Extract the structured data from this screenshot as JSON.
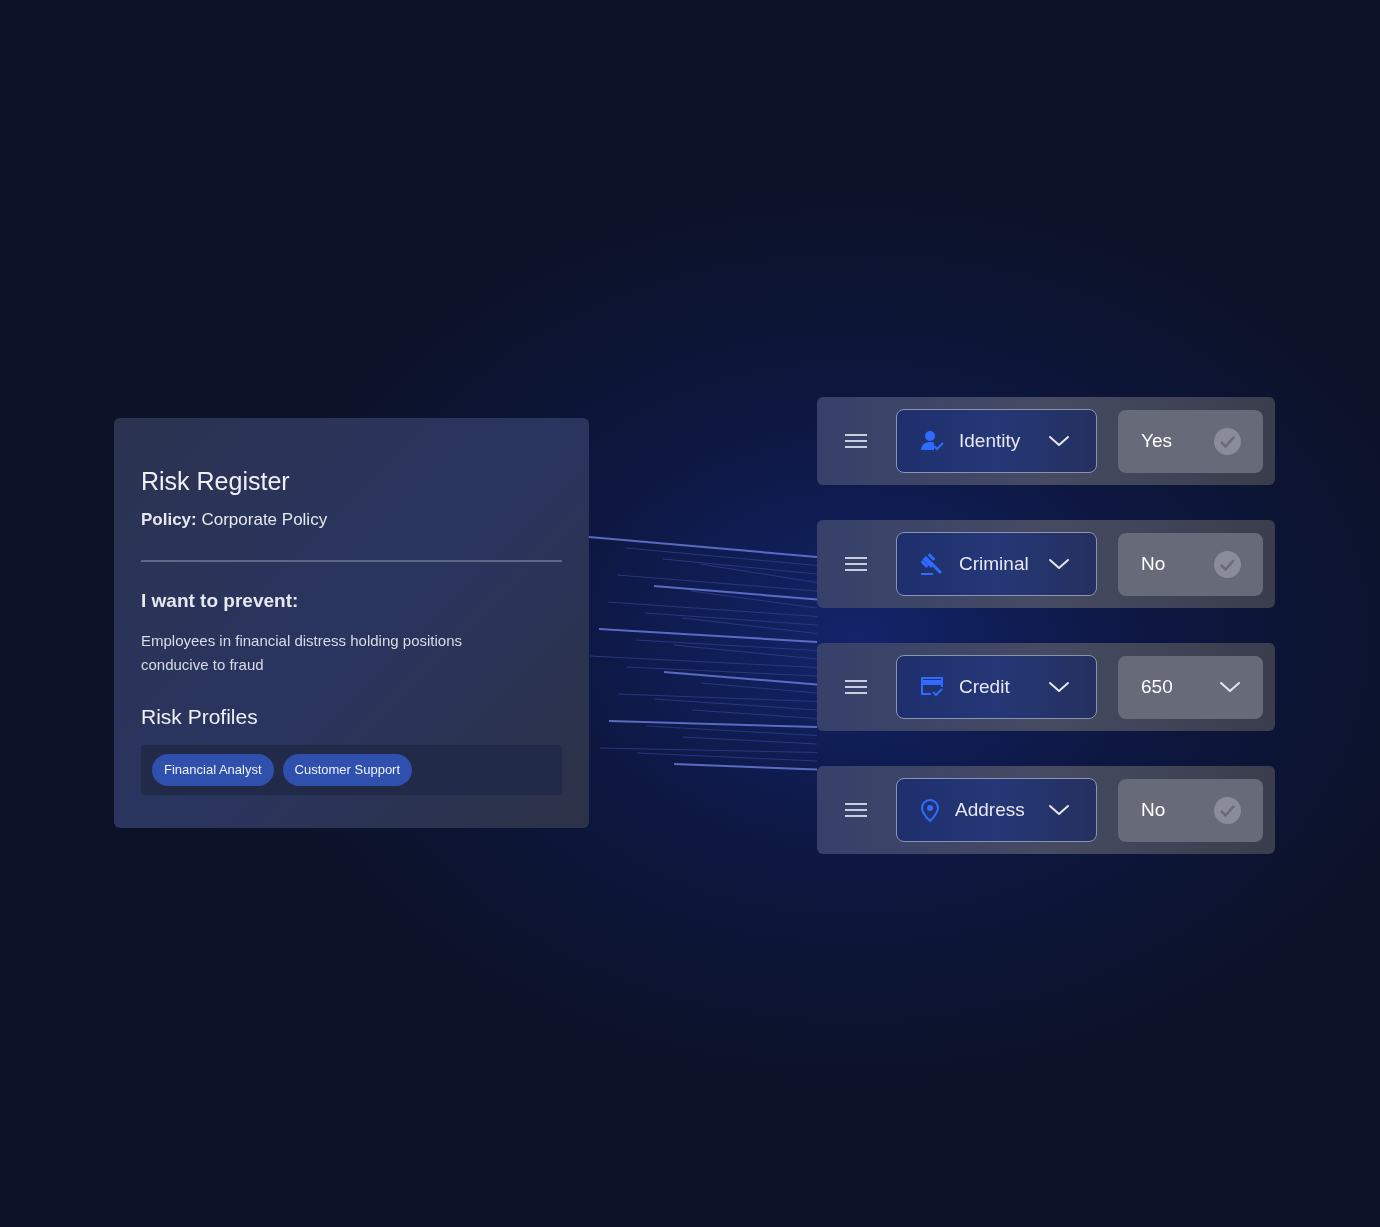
{
  "card": {
    "title": "Risk Register",
    "policy": "**Policy:** Corporate Policy",
    "prevent_heading": "I want to prevent:",
    "prevent_text": "Employees in financial distress holding positions conducive to fraud",
    "profiles_heading": "Risk Profiles",
    "profiles": [
      "Financial Analyst",
      "Customer Support"
    ]
  },
  "rules": [
    {
      "category": "Identity",
      "value": "Yes",
      "kind": "check"
    },
    {
      "category": "Criminal",
      "value": "No",
      "kind": "check"
    },
    {
      "category": "Credit",
      "value": "650",
      "kind": "select"
    },
    {
      "category": "Address",
      "value": "No",
      "kind": "check"
    }
  ]
}
